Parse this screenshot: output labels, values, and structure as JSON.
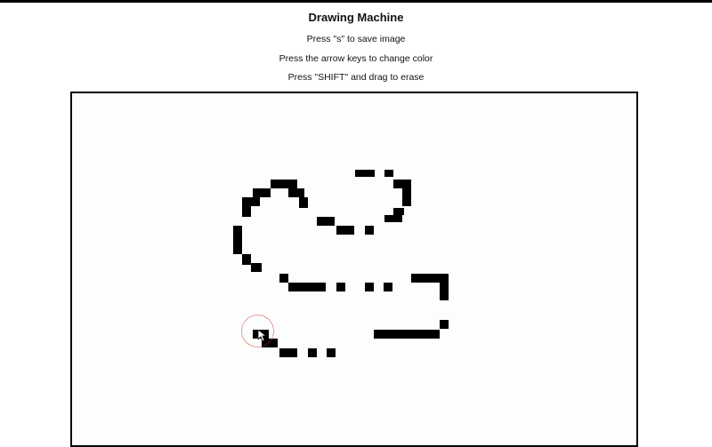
{
  "app": {
    "title": "Drawing Machine"
  },
  "instructions": [
    "Press \"s\" to save image",
    "Press the arrow keys to change color",
    "Press \"SHIFT\" and drag to erase"
  ],
  "canvas": {
    "background_color": "#ffffff",
    "border_color": "#000000",
    "stroke_color": "#000000",
    "state": "drawing in progress"
  },
  "cursor": {
    "indicator_color": "#c0392b",
    "icon": "arrow-pointer-icon"
  }
}
